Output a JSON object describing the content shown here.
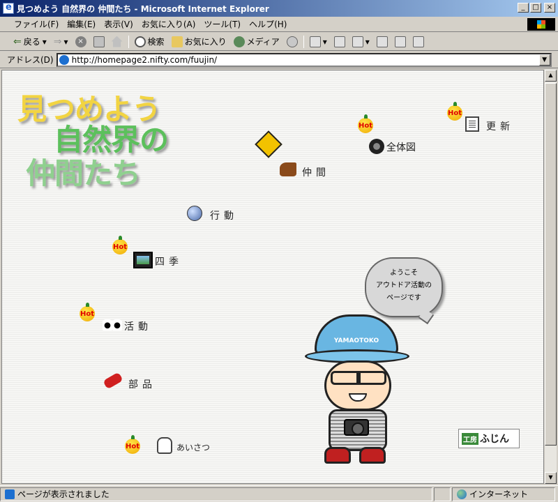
{
  "window": {
    "title": "見つめよう 自然界の 仲間たち - Microsoft Internet Explorer"
  },
  "menu": [
    "ファイル(F)",
    "編集(E)",
    "表示(V)",
    "お気に入り(A)",
    "ツール(T)",
    "ヘルプ(H)"
  ],
  "toolbar": {
    "back": "戻る",
    "search": "検索",
    "favorites": "お気に入り",
    "media": "メディア"
  },
  "address": {
    "label": "アドレス(D)",
    "url": "http://homepage2.nifty.com/fuujin/"
  },
  "page": {
    "logo": [
      "見つめよう",
      "自然界の",
      "仲間たち"
    ],
    "hot_label": "Hot",
    "nav": {
      "update": "更新",
      "map": "全体図",
      "friends": "仲間",
      "behavior": "行動",
      "seasons": "四季",
      "activities": "活動",
      "parts": "部品",
      "greeting": "あいさつ"
    },
    "bubble": [
      "ようこそ",
      "アウトドア活動の",
      "ページです"
    ],
    "cap_text": "YAMAOTOKO",
    "badge": {
      "left": "工房",
      "right": "ふじん"
    }
  },
  "status": {
    "left": "ページが表示されました",
    "zone": "インターネット"
  },
  "colors": {
    "titlebar": "#0a246a",
    "logo_yellow": "#f2d442",
    "logo_green": "#5cc05c",
    "hot_badge": "#ffd21a"
  }
}
